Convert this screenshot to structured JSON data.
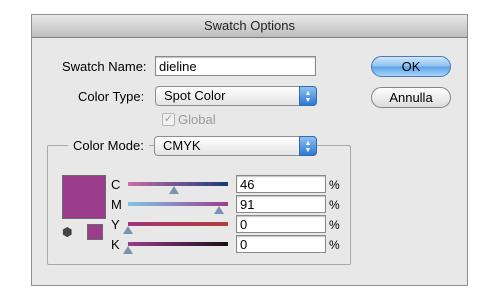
{
  "dialog": {
    "title": "Swatch Options",
    "swatch_name_label": "Swatch Name:",
    "swatch_name_value": "dieline",
    "color_type_label": "Color Type:",
    "color_type_value": "Spot Color",
    "global_label": "Global",
    "global_checked": true,
    "global_enabled": false,
    "color_mode_label": "Color Mode:",
    "color_mode_value": "CMYK",
    "ok_label": "OK",
    "cancel_label": "Annulla"
  },
  "swatch_color": "#9b3c8c",
  "channels": [
    {
      "name": "C",
      "value": "46",
      "unit": "%",
      "level": 0.46,
      "gradient": "linear-gradient(90deg,#c66fa8,#1c3a78)"
    },
    {
      "name": "M",
      "value": "91",
      "unit": "%",
      "level": 0.91,
      "gradient": "linear-gradient(90deg,#7fc6e6,#9b3c8c)"
    },
    {
      "name": "Y",
      "value": "0",
      "unit": "%",
      "level": 0.0,
      "gradient": "linear-gradient(90deg,#a0347f,#b03f3a)"
    },
    {
      "name": "K",
      "value": "0",
      "unit": "%",
      "level": 0.0,
      "gradient": "linear-gradient(90deg,#9b3c8c,#1a0d18)"
    }
  ]
}
